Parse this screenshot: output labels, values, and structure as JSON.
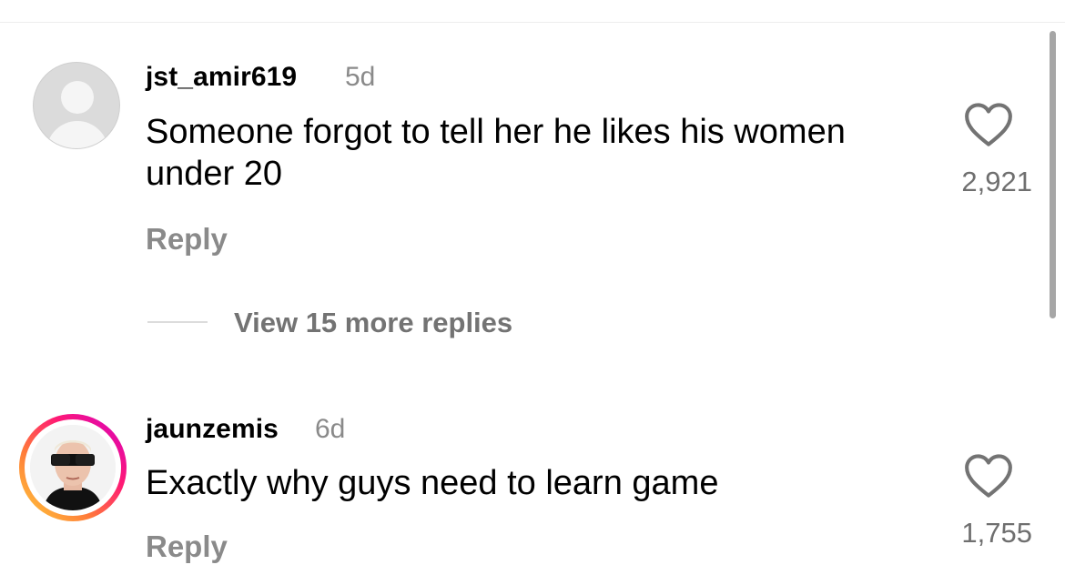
{
  "comments": [
    {
      "username": "jst_amir619",
      "time": "5d",
      "text": "Someone forgot to tell her he likes his women under 20",
      "reply_label": "Reply",
      "like_count": "2,921",
      "avatar": "default-avatar-icon"
    },
    {
      "username": "jaunzemis",
      "time": "6d",
      "text": "Exactly why guys need to learn game",
      "reply_label": "Reply",
      "like_count": "1,755",
      "avatar": "profile-photo-with-story-ring"
    }
  ],
  "view_replies": "View 15 more replies",
  "colors": {
    "text": "#000000",
    "secondary": "#8a8a8a",
    "story_ring": [
      "#ffd23a",
      "#ff1a74",
      "#d300c5"
    ]
  },
  "icons": {
    "like": "heart-outline-icon"
  }
}
